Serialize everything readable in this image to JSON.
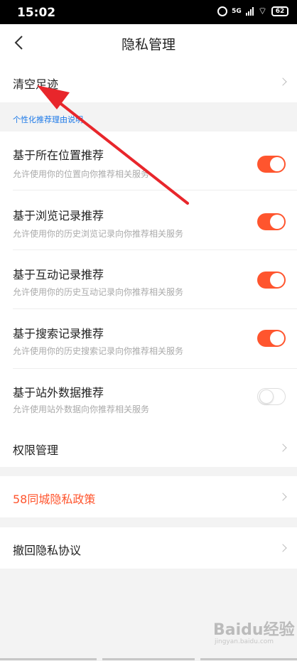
{
  "status_bar": {
    "time": "15:02",
    "network": "5G",
    "battery": "62"
  },
  "nav": {
    "title": "隐私管理"
  },
  "clear_history": {
    "label": "清空足迹"
  },
  "section_header": "个性化推荐理由说明",
  "recommend_items": [
    {
      "title": "基于所在位置推荐",
      "subtitle": "允许使用你的位置向你推荐相关服务",
      "enabled": true
    },
    {
      "title": "基于浏览记录推荐",
      "subtitle": "允许使用你的历史浏览记录向你推荐相关服务",
      "enabled": true
    },
    {
      "title": "基于互动记录推荐",
      "subtitle": "允许使用你的历史互动记录向你推荐相关服务",
      "enabled": true
    },
    {
      "title": "基于搜索记录推荐",
      "subtitle": "允许使用你的历史搜索记录向你推荐相关服务",
      "enabled": true
    },
    {
      "title": "基于站外数据推荐",
      "subtitle": "允许使用站外数据向你推荐相关服务",
      "enabled": false
    }
  ],
  "permission": {
    "label": "权限管理"
  },
  "privacy_policy": {
    "label": "58同城隐私政策",
    "color": "#ff552e"
  },
  "revoke": {
    "label": "撤回隐私协议"
  },
  "colors": {
    "accent": "#ff552e",
    "section_header": "#1e7ae8",
    "arrow": "#e8262b"
  },
  "watermark": {
    "text": "Baidu经验",
    "sub": "jingyan.baidu.com"
  }
}
